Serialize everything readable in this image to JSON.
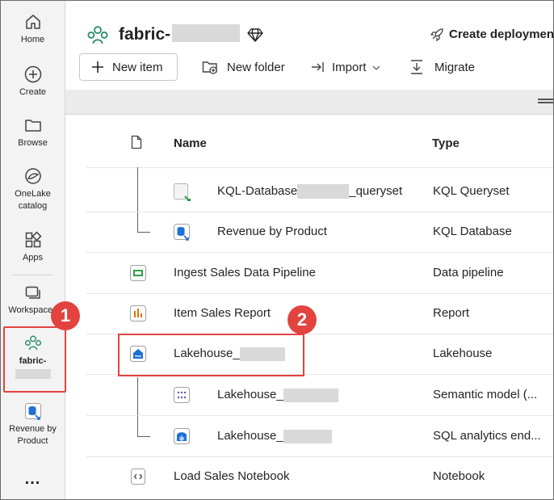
{
  "rail": {
    "items": [
      {
        "label": "Home",
        "icon": "home-icon"
      },
      {
        "label": "Create",
        "icon": "plus-circle-icon"
      },
      {
        "label": "Browse",
        "icon": "folder-icon"
      },
      {
        "label": "OneLake catalog",
        "icon": "onelake-icon"
      },
      {
        "label": "Apps",
        "icon": "apps-icon"
      },
      {
        "label": "Workspaces",
        "icon": "workspaces-icon"
      },
      {
        "label": "fabric-",
        "icon": "workspace-people-icon"
      },
      {
        "label": "Revenue by Product",
        "icon": "kql-database-icon"
      }
    ],
    "more": "..."
  },
  "header": {
    "workspace_title": "fabric-",
    "create_deployment": "Create deploymen",
    "new_item": "New item",
    "new_folder": "New folder",
    "import": "Import",
    "migrate": "Migrate"
  },
  "table": {
    "columns": {
      "name": "Name",
      "type": "Type"
    },
    "rows": [
      {
        "name": "KQL-Database",
        "name_suffix": "_queryset",
        "type": "KQL Queryset",
        "icon": "kql-queryset-icon"
      },
      {
        "name": "Revenue by Product",
        "type": "KQL Database",
        "icon": "kql-database-icon"
      },
      {
        "name": "Ingest Sales Data Pipeline",
        "type": "Data pipeline",
        "icon": "pipeline-icon"
      },
      {
        "name": "Item Sales Report",
        "type": "Report",
        "icon": "report-icon"
      },
      {
        "name": "Lakehouse_",
        "type": "Lakehouse",
        "icon": "lakehouse-icon"
      },
      {
        "name": "Lakehouse_",
        "type": "Semantic model (...",
        "icon": "semantic-model-icon"
      },
      {
        "name": "Lakehouse_",
        "type": "SQL analytics end...",
        "icon": "sql-endpoint-icon"
      },
      {
        "name": "Load Sales Notebook",
        "type": "Notebook",
        "icon": "notebook-icon"
      }
    ]
  },
  "annotations": {
    "badge1": "1",
    "badge2": "2"
  },
  "colors": {
    "accent_red": "#e3433f",
    "fabric_green": "#2f8f6f",
    "rail_bg": "#f3f3f3"
  }
}
